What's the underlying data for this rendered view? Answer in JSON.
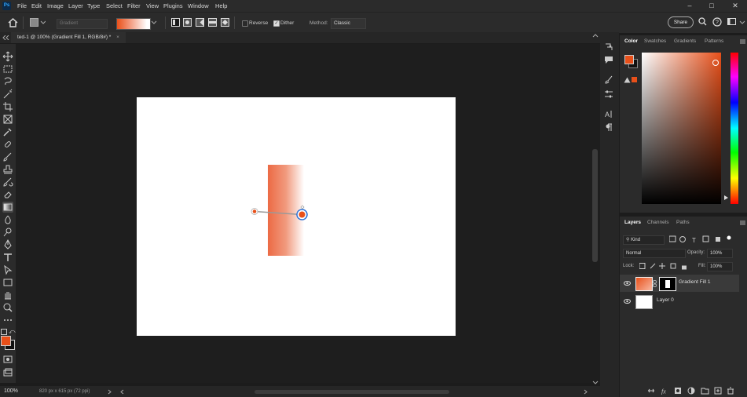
{
  "app": {
    "logo": "Ps"
  },
  "menu": [
    "File",
    "Edit",
    "Image",
    "Layer",
    "Type",
    "Select",
    "Filter",
    "View",
    "Plugins",
    "Window",
    "Help"
  ],
  "window_controls": {
    "minimize": "–",
    "maximize": "□",
    "close": "✕"
  },
  "options": {
    "preset_label": "Gradient",
    "reverse_label": "Reverse",
    "dither_label": "Dither",
    "method_label": "Method:",
    "method_value": "Classic",
    "share_label": "Share",
    "reverse_checked": false,
    "dither_checked": true
  },
  "document_tab": {
    "title": "ted-1 @ 100% (Gradient Fill 1, RGB/8#) *",
    "close": "×"
  },
  "status": {
    "zoom": "100%",
    "doc_info": "820 px x 615 px (72 ppi)"
  },
  "colors": {
    "foreground": "#e8501a",
    "background": "#111111",
    "accent": "#e8501a",
    "gradient_start": "#ec6a44"
  },
  "color_panel": {
    "tabs": [
      "Color",
      "Swatches",
      "Gradients",
      "Patterns"
    ]
  },
  "layers_panel": {
    "tabs": [
      "Layers",
      "Channels",
      "Paths"
    ],
    "filter_kind": "Kind",
    "blend_mode": "Normal",
    "opacity_label": "Opacity:",
    "opacity_value": "100%",
    "lock_label": "Lock:",
    "fill_label": "Fill:",
    "fill_value": "100%",
    "layers": [
      {
        "name": "Gradient Fill 1",
        "selected": true
      },
      {
        "name": "Layer 0",
        "selected": false
      }
    ]
  },
  "icons": {
    "toolbar": [
      "move-icon",
      "marquee-icon",
      "lasso-icon",
      "magic-wand-icon",
      "crop-icon",
      "frame-icon",
      "eyedropper-icon",
      "healing-icon",
      "brush-icon",
      "stamp-icon",
      "history-brush-icon",
      "eraser-icon",
      "gradient-icon",
      "blur-icon",
      "dodge-icon",
      "pen-icon",
      "type-icon",
      "path-select-icon",
      "rectangle-icon",
      "hand-icon",
      "zoom-icon",
      "more-icon"
    ]
  }
}
